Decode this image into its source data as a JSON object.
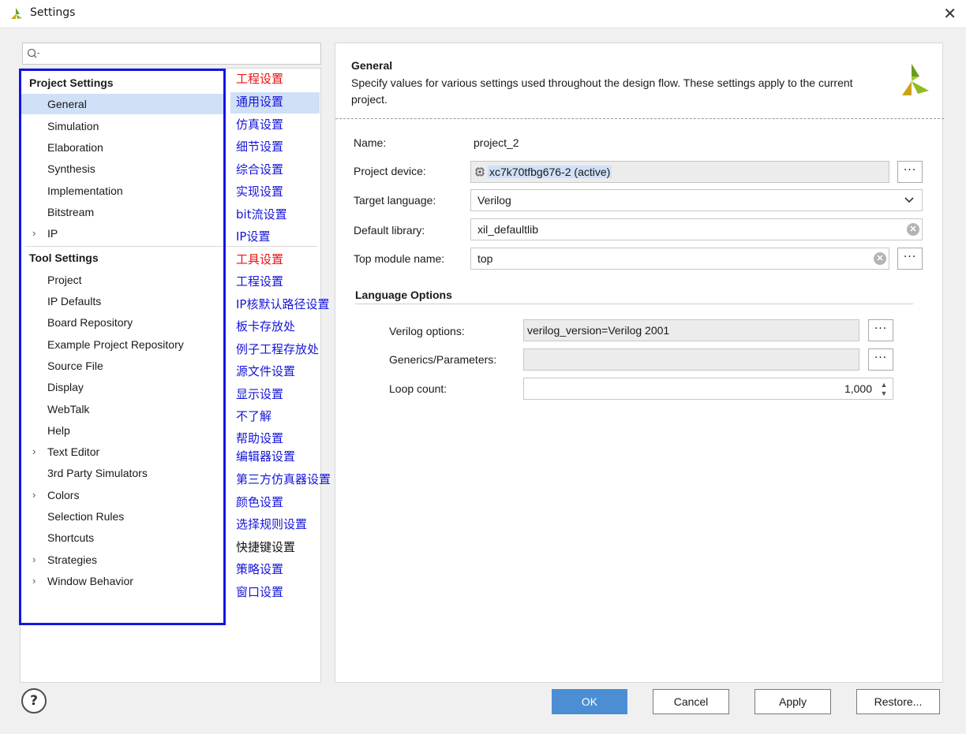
{
  "window": {
    "title": "Settings",
    "close_glyph": "✕"
  },
  "search": {
    "placeholder": "Q-"
  },
  "tree": {
    "project_header": "Project Settings",
    "project_items": [
      {
        "label": "General",
        "chevron": false,
        "selected": true
      },
      {
        "label": "Simulation",
        "chevron": false
      },
      {
        "label": "Elaboration",
        "chevron": false
      },
      {
        "label": "Synthesis",
        "chevron": false
      },
      {
        "label": "Implementation",
        "chevron": false
      },
      {
        "label": "Bitstream",
        "chevron": false
      },
      {
        "label": "IP",
        "chevron": true
      }
    ],
    "tool_header": "Tool Settings",
    "tool_items": [
      {
        "label": "Project",
        "chevron": false
      },
      {
        "label": "IP Defaults",
        "chevron": false
      },
      {
        "label": "Board Repository",
        "chevron": false
      },
      {
        "label": "Example Project Repository",
        "chevron": false
      },
      {
        "label": "Source File",
        "chevron": false
      },
      {
        "label": "Display",
        "chevron": false
      },
      {
        "label": "WebTalk",
        "chevron": false
      },
      {
        "label": "Help",
        "chevron": false
      },
      {
        "label": "Text Editor",
        "chevron": true
      },
      {
        "label": "3rd Party Simulators",
        "chevron": false
      },
      {
        "label": "Colors",
        "chevron": true
      },
      {
        "label": "Selection Rules",
        "chevron": false
      },
      {
        "label": "Shortcuts",
        "chevron": false
      },
      {
        "label": "Strategies",
        "chevron": true
      },
      {
        "label": "Window Behavior",
        "chevron": true
      }
    ]
  },
  "annotations": [
    {
      "text": "工程设置",
      "color": "red"
    },
    {
      "text": "通用设置",
      "color": "blue"
    },
    {
      "text": "仿真设置",
      "color": "blue"
    },
    {
      "text": "细节设置",
      "color": "blue"
    },
    {
      "text": "综合设置",
      "color": "blue"
    },
    {
      "text": "实现设置",
      "color": "blue"
    },
    {
      "text": "bit流设置",
      "color": "blue"
    },
    {
      "text": "IP设置",
      "color": "blue"
    },
    {
      "text": "工具设置",
      "color": "red"
    },
    {
      "text": "工程设置",
      "color": "blue"
    },
    {
      "text": "IP核默认路径设置",
      "color": "blue"
    },
    {
      "text": "板卡存放处",
      "color": "blue"
    },
    {
      "text": "例子工程存放处",
      "color": "blue"
    },
    {
      "text": "源文件设置",
      "color": "blue"
    },
    {
      "text": "显示设置",
      "color": "blue"
    },
    {
      "text": "不了解",
      "color": "blue"
    },
    {
      "text": "帮助设置",
      "color": "blue"
    },
    {
      "text": "编辑器设置",
      "color": "blue"
    },
    {
      "text": "第三方仿真器设置",
      "color": "blue"
    },
    {
      "text": "颜色设置",
      "color": "blue"
    },
    {
      "text": "选择规则设置",
      "color": "blue"
    },
    {
      "text": "快捷键设置",
      "color": "black"
    },
    {
      "text": "策略设置",
      "color": "blue"
    },
    {
      "text": "窗口设置",
      "color": "blue"
    }
  ],
  "general": {
    "title": "General",
    "description": "Specify values for various settings used throughout the design flow. These settings apply to the current project.",
    "name_label": "Name:",
    "name_value": "project_2",
    "device_label": "Project device:",
    "device_value": "xc7k70tfbg676-2 (active)",
    "language_label": "Target language:",
    "language_value": "Verilog",
    "library_label": "Default library:",
    "library_value": "xil_defaultlib",
    "top_label": "Top module name:",
    "top_value": "top",
    "dots": "···"
  },
  "language_options": {
    "title": "Language Options",
    "verilog_label": "Verilog options:",
    "verilog_value": "verilog_version=Verilog 2001",
    "generics_label": "Generics/Parameters:",
    "generics_value": "",
    "loop_label": "Loop count:",
    "loop_value": "1,000"
  },
  "buttons": {
    "help": "?",
    "ok": "OK",
    "cancel": "Cancel",
    "apply": "Apply",
    "restore": "Restore..."
  },
  "colors": {
    "accent": "#4b8ed3",
    "selection": "#cfe0f7",
    "annotation_box": "#1414e6",
    "annotation_red": "#e81414",
    "annotation_blue": "#1515d8"
  }
}
